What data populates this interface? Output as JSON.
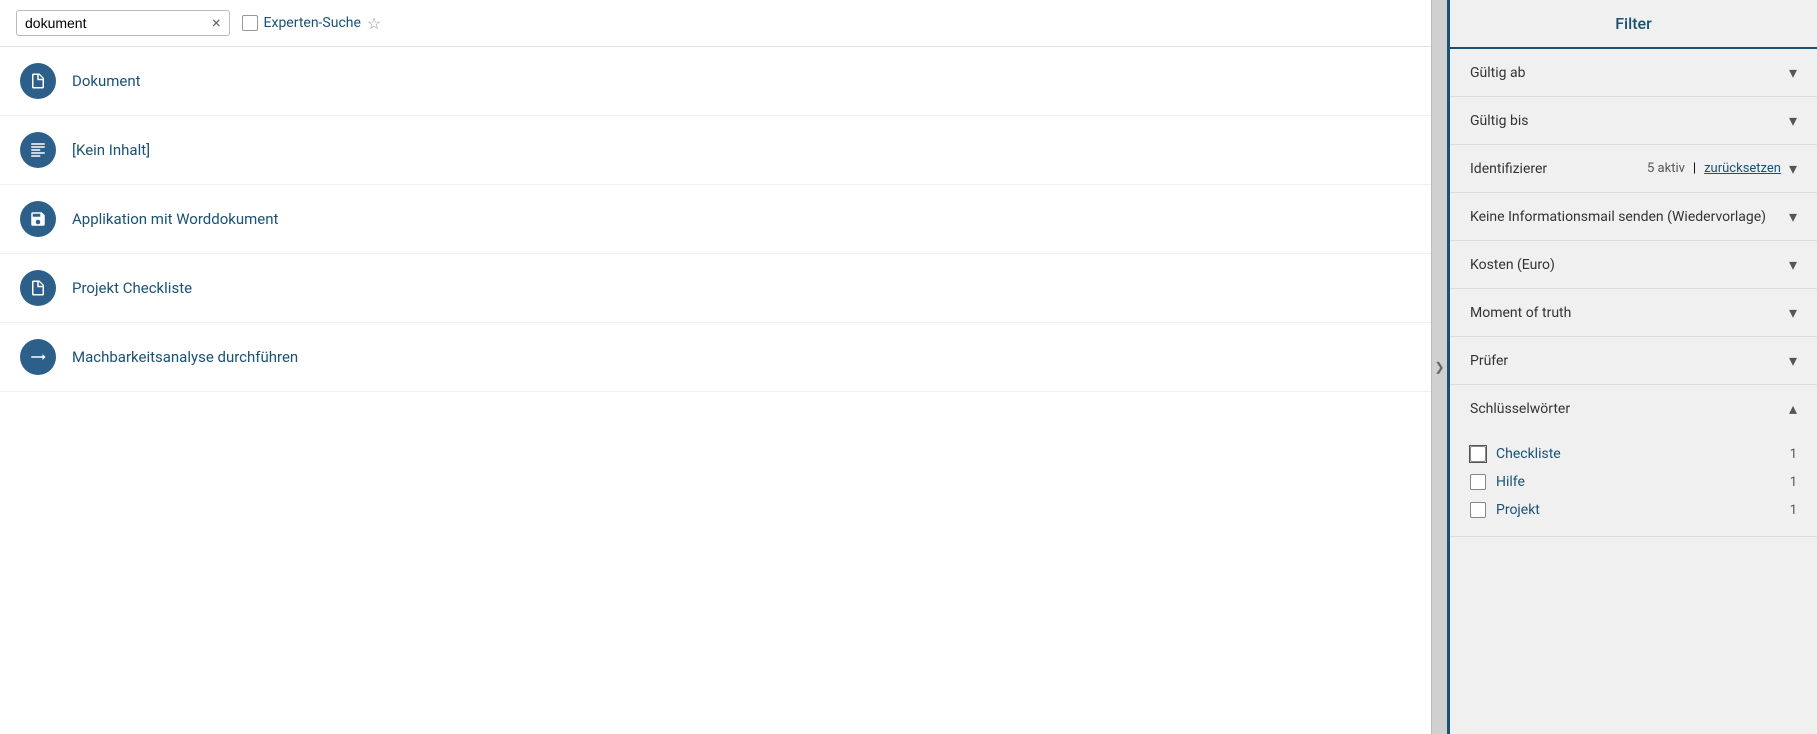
{
  "search": {
    "value": "dokument",
    "placeholder": "dokument",
    "clear_label": "×",
    "experten_label": "Experten-Suche",
    "star_char": "☆"
  },
  "results": [
    {
      "id": 1,
      "title": "Dokument",
      "icon_type": "document"
    },
    {
      "id": 2,
      "title": "[Kein Inhalt]",
      "icon_type": "text"
    },
    {
      "id": 3,
      "title": "Applikation mit Worddokument",
      "icon_type": "disk"
    },
    {
      "id": 4,
      "title": "Projekt Checkliste",
      "icon_type": "document"
    },
    {
      "id": 5,
      "title": "Machbarkeitsanalyse durchführen",
      "icon_type": "arrow"
    }
  ],
  "filter": {
    "title": "Filter",
    "sections": [
      {
        "id": "gueltig_ab",
        "label": "Gültig ab",
        "expanded": false,
        "active_count": null,
        "reset_label": null
      },
      {
        "id": "gueltig_bis",
        "label": "Gültig bis",
        "expanded": false,
        "active_count": null,
        "reset_label": null
      },
      {
        "id": "identifizierer",
        "label": "Identifizierer",
        "expanded": false,
        "active_count": "5 aktiv",
        "separator": "|",
        "reset_label": "zurücksetzen"
      },
      {
        "id": "keine_informationsmail",
        "label": "Keine Informationsmail senden (Wiedervorlage)",
        "expanded": false,
        "active_count": null,
        "reset_label": null
      },
      {
        "id": "kosten",
        "label": "Kosten (Euro)",
        "expanded": false,
        "active_count": null,
        "reset_label": null
      },
      {
        "id": "moment_of_truth",
        "label": "Moment of truth",
        "expanded": false,
        "active_count": null,
        "reset_label": null
      },
      {
        "id": "pruefer",
        "label": "Prüfer",
        "expanded": false,
        "active_count": null,
        "reset_label": null
      },
      {
        "id": "schluesselwoerter",
        "label": "Schlüsselwörter",
        "expanded": true,
        "active_count": null,
        "reset_label": null
      }
    ],
    "keywords": [
      {
        "label": "Checkliste",
        "count": 1,
        "checked": false,
        "hover": true
      },
      {
        "label": "Hilfe",
        "count": 1,
        "checked": false,
        "hover": false
      },
      {
        "label": "Projekt",
        "count": 1,
        "checked": false,
        "hover": false
      }
    ]
  },
  "icons": {
    "chevron_down": "▾",
    "chevron_up": "▴",
    "chevron_right": "❯"
  }
}
